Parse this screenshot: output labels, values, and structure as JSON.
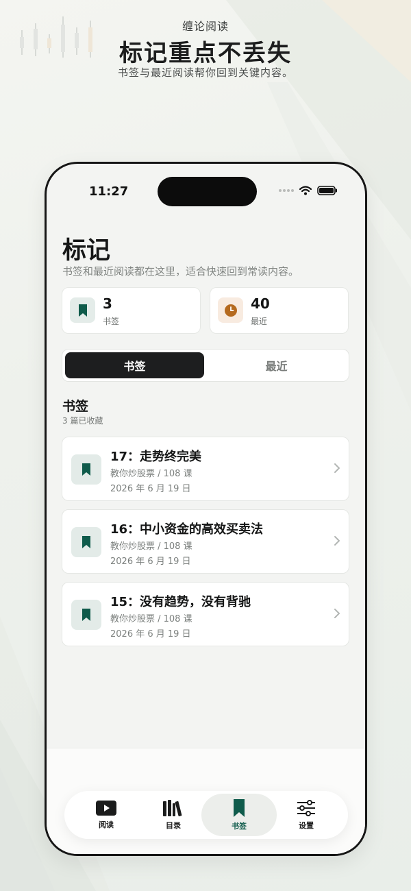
{
  "colors": {
    "accent": "#0f5b4b",
    "accent_bg": "#e3ebe8",
    "orange": "#b56a1f",
    "orange_bg": "#f8ebe0",
    "dark": "#1d1e1f"
  },
  "promo": {
    "eyebrow": "缠论阅读",
    "title": "标记重点不丢失",
    "subtitle": "书签与最近阅读帮你回到关键内容。"
  },
  "status_bar": {
    "time": "11:27"
  },
  "page": {
    "title": "标记",
    "subtitle": "书签和最近阅读都在这里，适合快速回到常读内容。"
  },
  "stats": [
    {
      "value": "3",
      "label": "书签",
      "icon": "bookmark-icon"
    },
    {
      "value": "40",
      "label": "最近",
      "icon": "clock-icon"
    }
  ],
  "segments": {
    "active": "书签",
    "inactive": "最近"
  },
  "section": {
    "title": "书签",
    "count": "3 篇已收藏"
  },
  "bookmarks": [
    {
      "title": "17：走势终完美",
      "meta": "教你炒股票 / 108 课",
      "date": "2026 年 6 月 19 日"
    },
    {
      "title": "16：中小资金的高效买卖法",
      "meta": "教你炒股票 / 108 课",
      "date": "2026 年 6 月 19 日"
    },
    {
      "title": "15：没有趋势，没有背驰",
      "meta": "教你炒股票 / 108 课",
      "date": "2026 年 6 月 19 日"
    }
  ],
  "tabbar": [
    {
      "label": "阅读",
      "icon": "play-icon",
      "active": false
    },
    {
      "label": "目录",
      "icon": "books-icon",
      "active": false
    },
    {
      "label": "书签",
      "icon": "bookmark-icon",
      "active": true
    },
    {
      "label": "设置",
      "icon": "sliders-icon",
      "active": false
    }
  ]
}
